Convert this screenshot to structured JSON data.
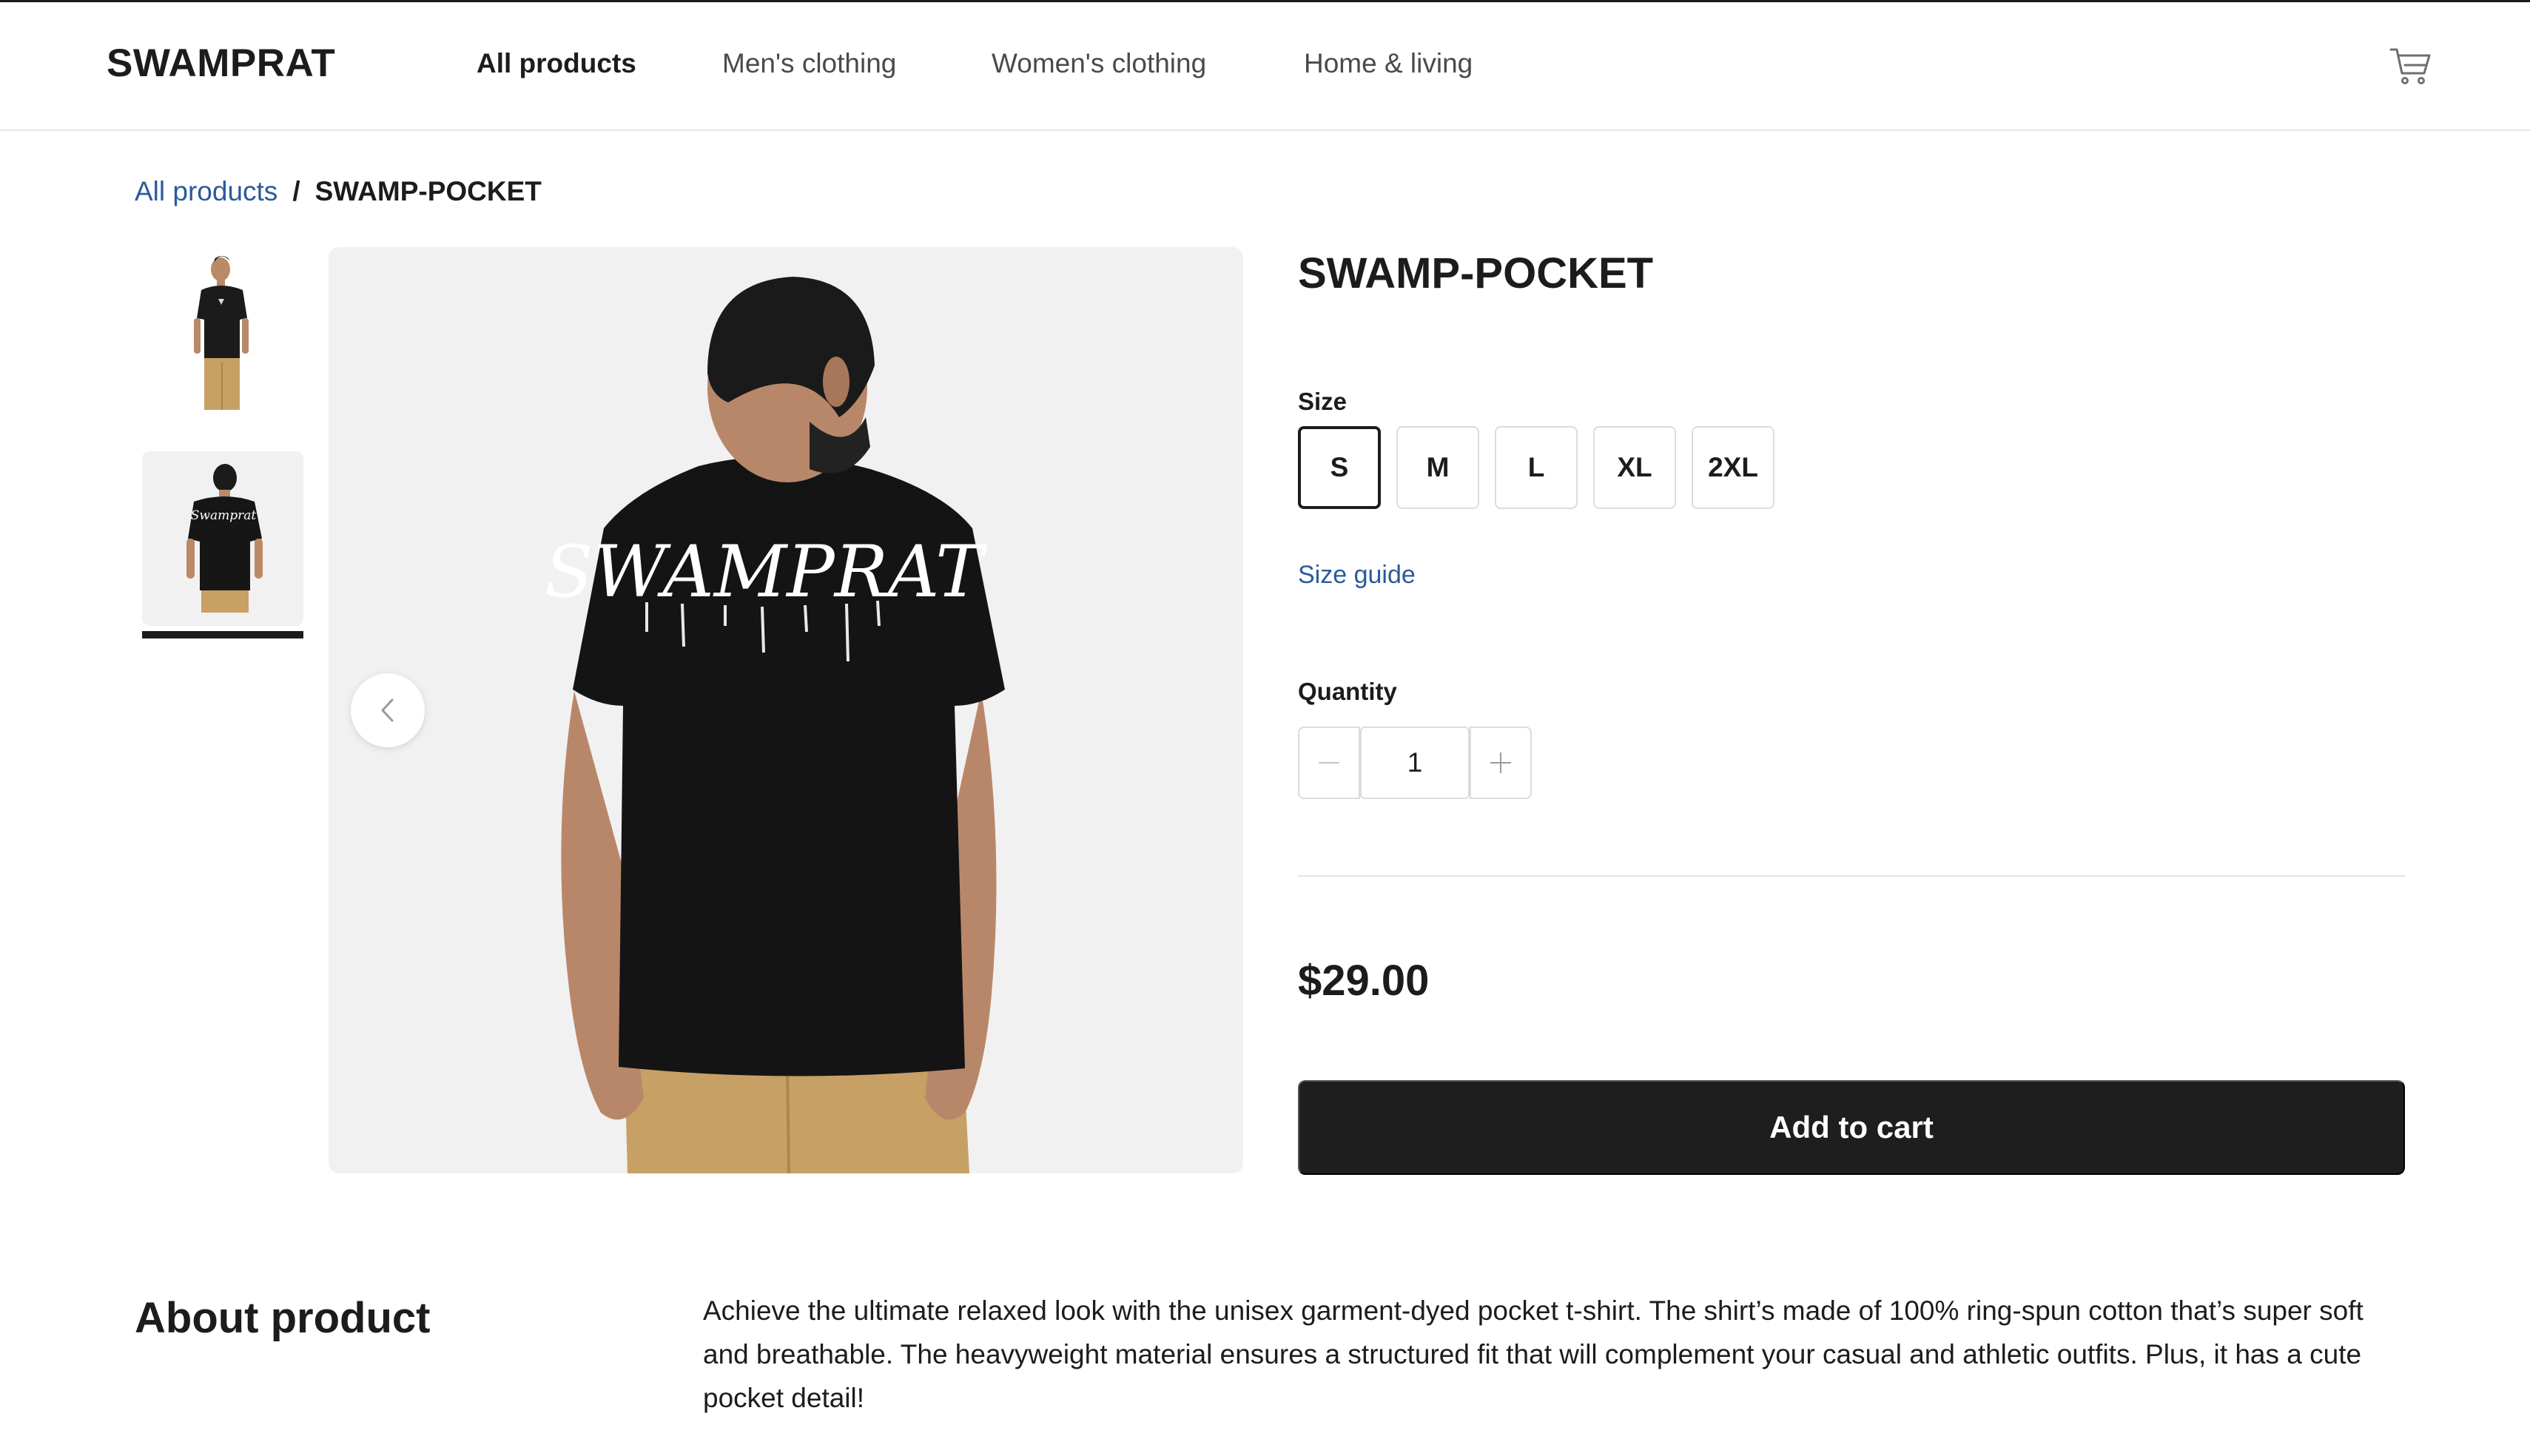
{
  "header": {
    "logo": "SWAMPRAT",
    "nav": [
      {
        "label": "All products",
        "active": true
      },
      {
        "label": "Men's clothing",
        "active": false
      },
      {
        "label": "Women's clothing",
        "active": false
      },
      {
        "label": "Home & living",
        "active": false
      }
    ],
    "cart_icon": "cart-icon"
  },
  "breadcrumb": {
    "parent": "All products",
    "separator": "/",
    "current": "SWAMP-POCKET"
  },
  "gallery": {
    "selected_index": 1,
    "thumbnail_count": 2,
    "main_print_text": "SWAMPRAT",
    "prev_icon": "chevron-left-icon"
  },
  "product": {
    "title": "SWAMP-POCKET",
    "size_label": "Size",
    "sizes": [
      "S",
      "M",
      "L",
      "XL",
      "2XL"
    ],
    "selected_size": "S",
    "size_guide": "Size guide",
    "quantity_label": "Quantity",
    "quantity": "1",
    "price": "$29.00",
    "add_to_cart": "Add to cart"
  },
  "about": {
    "heading": "About product",
    "text": "Achieve the ultimate relaxed look with the unisex garment-dyed pocket t-shirt. The shirt’s made of 100% ring-spun cotton that’s super soft and breathable. The heavyweight material ensures a structured fit that will complement your casual and athletic outfits. Plus, it has a cute pocket detail!"
  },
  "colors": {
    "text": "#1c1c1c",
    "link": "#2a5a9c",
    "button": "#1e1e1e",
    "image_bg": "#f2f1f1",
    "border": "#dcdcdc"
  }
}
